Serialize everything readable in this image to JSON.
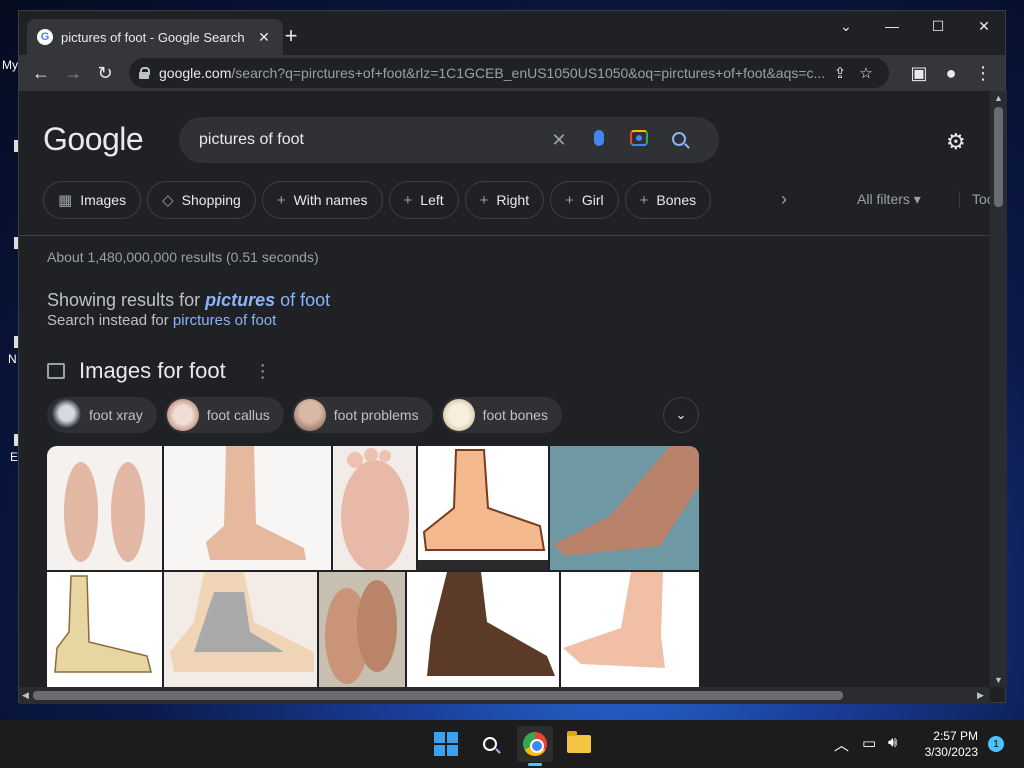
{
  "desktop": {
    "icon_labels": [
      "My",
      "N",
      "E"
    ]
  },
  "browser": {
    "tab_title": "pictures of foot - Google Search",
    "url_host": "google.com",
    "url_rest": "/search?q=pirctures+of+foot&rlz=1C1GCEB_enUS1050US1050&oq=pirctures+of+foot&aqs=c..."
  },
  "google": {
    "logo": "Google",
    "query": "pictures of foot",
    "chips": [
      {
        "icon": "image-icon",
        "label": "Images"
      },
      {
        "icon": "tag-icon",
        "label": "Shopping"
      },
      {
        "icon": "plus-icon",
        "label": "With names"
      },
      {
        "icon": "plus-icon",
        "label": "Left"
      },
      {
        "icon": "plus-icon",
        "label": "Right"
      },
      {
        "icon": "plus-icon",
        "label": "Girl"
      },
      {
        "icon": "plus-icon",
        "label": "Bones"
      }
    ],
    "all_filters": "All filters",
    "tools": "Tools",
    "stats": "About 1,480,000,000 results (0.51 seconds)",
    "showing_prefix": "Showing results for",
    "showing_bold": "pictures",
    "showing_rest": "of foot",
    "instead_prefix": "Search instead for",
    "instead_link": "pirctures of foot",
    "images_heading": "Images for foot",
    "refinements": [
      {
        "label": "foot xray",
        "color": "#5a5f66"
      },
      {
        "label": "foot callus",
        "color": "#d9b8a8"
      },
      {
        "label": "foot problems",
        "color": "#b89a8e"
      },
      {
        "label": "foot bones",
        "color": "#e8dcc4"
      }
    ]
  },
  "taskbar": {
    "time": "2:57 PM",
    "date": "3/30/2023",
    "notifications": "1"
  },
  "colors": {
    "page_bg": "#202124",
    "link": "#8ab4f8",
    "accent": "#4cc2ff"
  }
}
